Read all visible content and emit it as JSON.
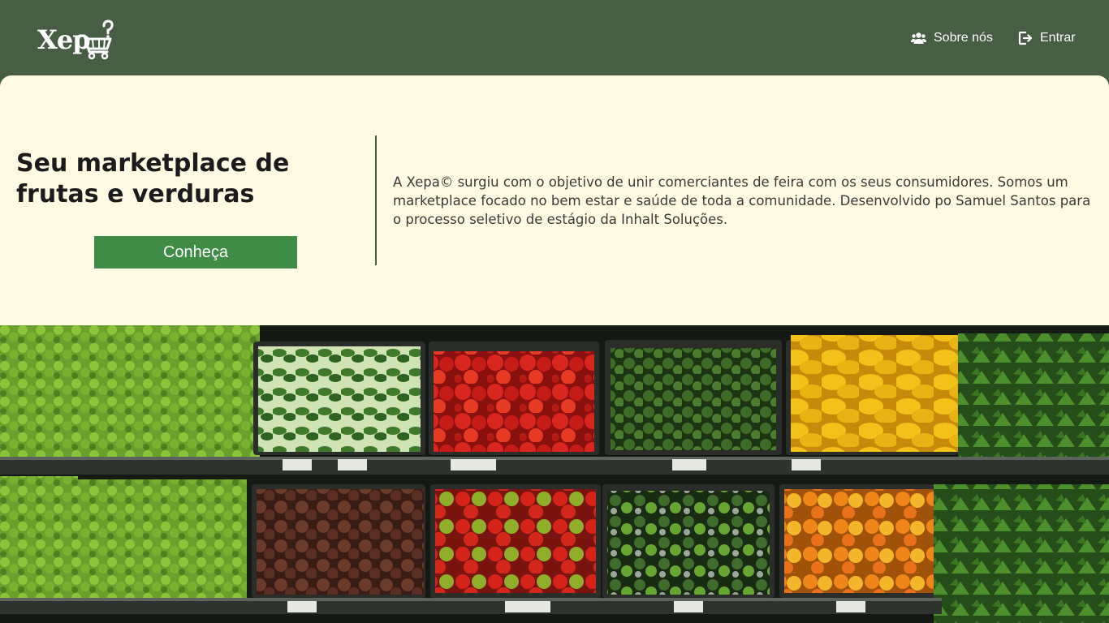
{
  "navbar": {
    "logo_text": "Xep",
    "about_label": "Sobre nós",
    "login_label": "Entrar"
  },
  "hero": {
    "title": "Seu marketplace de frutas e verduras",
    "cta_label": "Conheça",
    "description": "A Xepa© surgiu com o objetivo de unir comerciantes de feira com os seus consumidores. Somos um marketplace focado no bem estar e saúde de toda a comunidade. Desenvolvido po Samuel Santos para o processo seletivo de estágio da Inhalt Soluções."
  },
  "colors": {
    "navbar_bg": "#475e45",
    "hero_bg": "#fefae3",
    "accent": "#3f8c46",
    "divider": "#4b5a48"
  },
  "icons": {
    "logo": "cart-question-icon",
    "about": "users-icon",
    "login": "sign-in-icon"
  }
}
